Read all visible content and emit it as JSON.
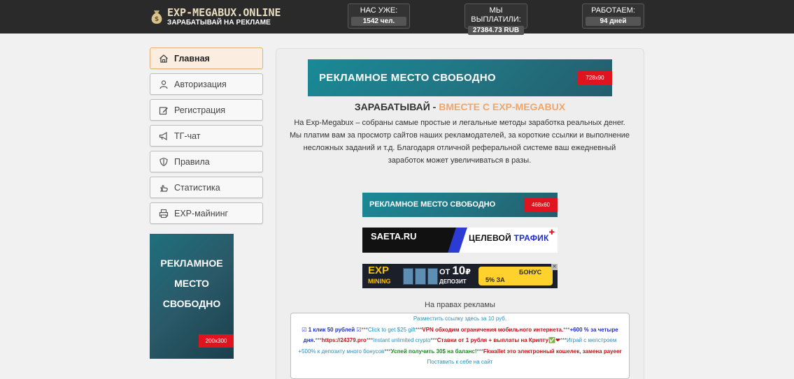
{
  "header": {
    "logo_title": "EXP-MEGABUX.ONLINE",
    "logo_subtitle": "ЗАРАБАТЫВАЙ НА РЕКЛАМЕ",
    "stats": [
      {
        "label": "НАС УЖЕ:",
        "value": "1542 чел."
      },
      {
        "label": "МЫ ВЫПЛАТИЛИ:",
        "value": "27384.73 RUB"
      },
      {
        "label": "РАБОТАЕМ:",
        "value": "94 дней"
      }
    ]
  },
  "sidebar": {
    "items": [
      {
        "label": "Главная",
        "icon": "home-icon"
      },
      {
        "label": "Авторизация",
        "icon": "user-icon"
      },
      {
        "label": "Регистрация",
        "icon": "edit-icon"
      },
      {
        "label": "ТГ-чат",
        "icon": "megaphone-icon"
      },
      {
        "label": "Правила",
        "icon": "shield-icon"
      },
      {
        "label": "Статистика",
        "icon": "hand-icon"
      },
      {
        "label": "EXP-майнинг",
        "icon": "printer-icon"
      }
    ],
    "banner": {
      "lines": [
        "РЕКЛАМНОЕ",
        "МЕСТО",
        "СВОБОДНО"
      ],
      "size": "200x300"
    }
  },
  "main": {
    "top_banner": {
      "text": "РЕКЛАМНОЕ  МЕСТО СВОБОДНО",
      "size": "728x90"
    },
    "headline_part1": "ЗАРАБАТЫВАЙ -",
    "headline_part2": "ВМЕСТЕ С EXP-MEGABUX",
    "intro": "На Exp-Megabux – собраны самые простые и легальные методы заработка реальных денег. Мы платим вам за просмотр сайтов наших рекламодателей, за короткие ссылки и выполнение несложных заданий и т.д. Благодаря отличной реферальной системе ваш ежедневный заработок может увеличиваться в разы.",
    "mid_banner": {
      "text": "РЕКЛАМНОЕ  МЕСТО СВОБОДНО",
      "size": "468x60"
    },
    "saeta": {
      "name": "SAETA.RU",
      "tag1": "ЦЕЛЕВОЙ",
      "tag2": "ТРАФИК",
      "plus": "✚"
    },
    "exp_ad": {
      "logo": "EXP",
      "logo_sub": "MINING",
      "from": "ОТ",
      "amount": "10",
      "currency": "₽",
      "dep": "ДЕПОЗИТ",
      "bonus1": "БОНУС",
      "bonus2": "5% ЗА",
      "close": "✕"
    },
    "ad_caption": "На правах рекламы",
    "adbox": {
      "top": "Разместить ссылку здесь за 10 руб.",
      "l1_blue": "☑ 1 клик 50 рублей ☑",
      "l1_sep1": "***",
      "l1_link1": "Click to get $25 gift",
      "l1_sep2": "***",
      "l1_red1": "VPN обходим ограничения мобильного интернета.",
      "l1_sep3": "***",
      "l1_blue2": "+600 % за четыре дня.",
      "l2_sep1": "***",
      "l2_red1": "https://24379.pro",
      "l2_sep2": "***",
      "l2_link1": "Instant unlimited crypto",
      "l2_sep3": "***",
      "l2_red2": "Ставки от 1 рубля + выплаты на Крипту✅❤",
      "l2_sep4": "***",
      "l2_link2": "Играй с мелстроем +500% к депозиту много бонусов",
      "l3_sep1": "***",
      "l3_green": "Успей получить 30$ на баланс!",
      "l3_sep2": "***",
      "l3_red": "Fkwallet это электронный кошелек, замена payeer",
      "bottom": "Поставить к себе на сайт"
    }
  }
}
